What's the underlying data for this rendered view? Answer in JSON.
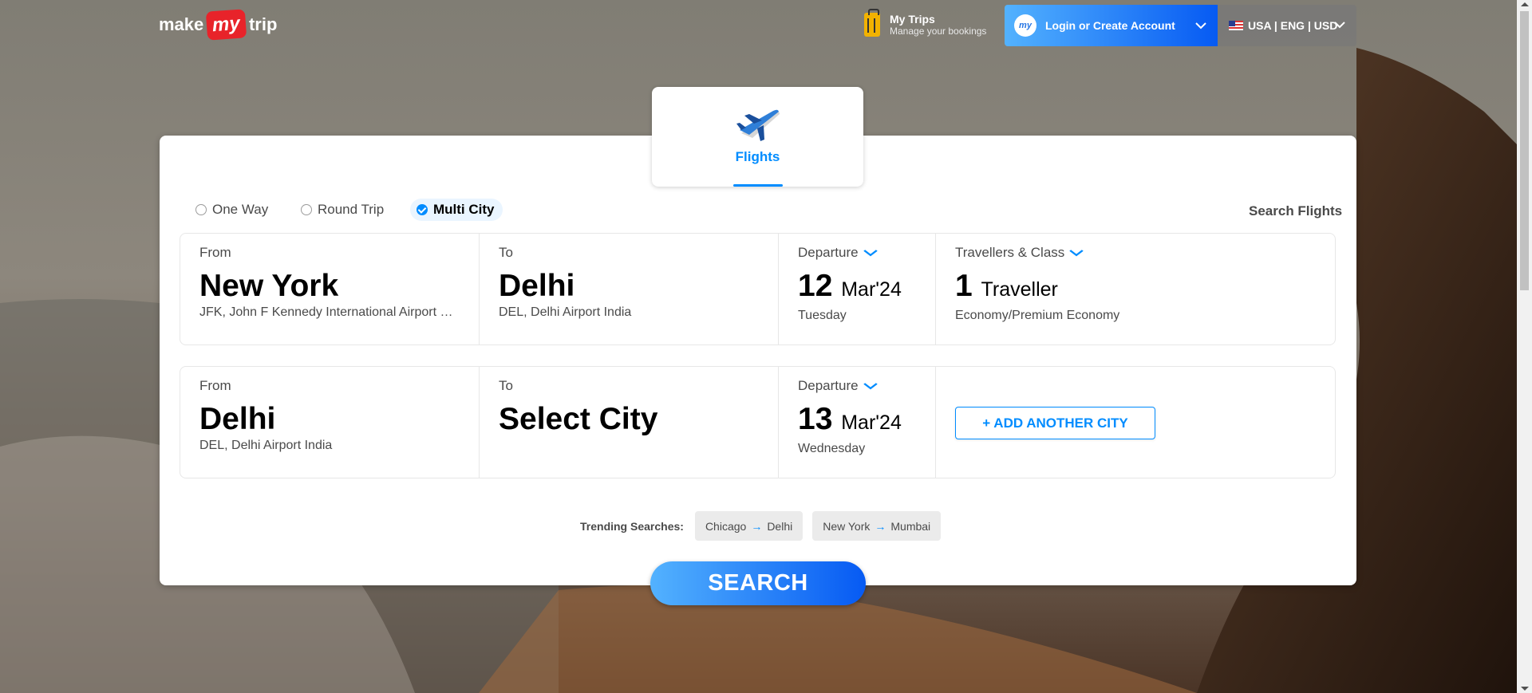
{
  "header": {
    "logo_make": "make",
    "logo_my": "my",
    "logo_trip": "trip",
    "my_trips_title": "My Trips",
    "my_trips_sub": "Manage your bookings",
    "login_label": "Login or Create Account",
    "login_badge": "my",
    "locale_label": "USA | ENG | USD"
  },
  "tabs": {
    "flights_label": "Flights"
  },
  "trip_types": {
    "one_way": "One Way",
    "round_trip": "Round Trip",
    "multi_city": "Multi City",
    "selected": "multi_city"
  },
  "search_flights_label": "Search Flights",
  "segments": [
    {
      "from_label": "From",
      "from_city": "New York",
      "from_airport": "JFK, John F Kennedy International Airport USA",
      "to_label": "To",
      "to_city": "Delhi",
      "to_airport": "DEL, Delhi Airport India",
      "departure_label": "Departure",
      "date_day": "12",
      "date_month": "Mar'24",
      "weekday": "Tuesday",
      "travellers_label": "Travellers & Class",
      "travellers_count": "1",
      "travellers_word": "Traveller",
      "travel_class": "Economy/Premium Economy"
    },
    {
      "from_label": "From",
      "from_city": "Delhi",
      "from_airport": "DEL, Delhi Airport India",
      "to_label": "To",
      "to_city": "Select City",
      "departure_label": "Departure",
      "date_day": "13",
      "date_month": "Mar'24",
      "weekday": "Wednesday",
      "add_city_label": "+ ADD ANOTHER CITY"
    }
  ],
  "trending": {
    "label": "Trending Searches:",
    "items": [
      {
        "from": "Chicago",
        "to": "Delhi"
      },
      {
        "from": "New York",
        "to": "Mumbai"
      }
    ]
  },
  "search_button": "SEARCH",
  "colors": {
    "accent": "#008cff",
    "brand_red": "#e8232a",
    "gradient_start": "#53b2fe",
    "gradient_end": "#065af3"
  }
}
